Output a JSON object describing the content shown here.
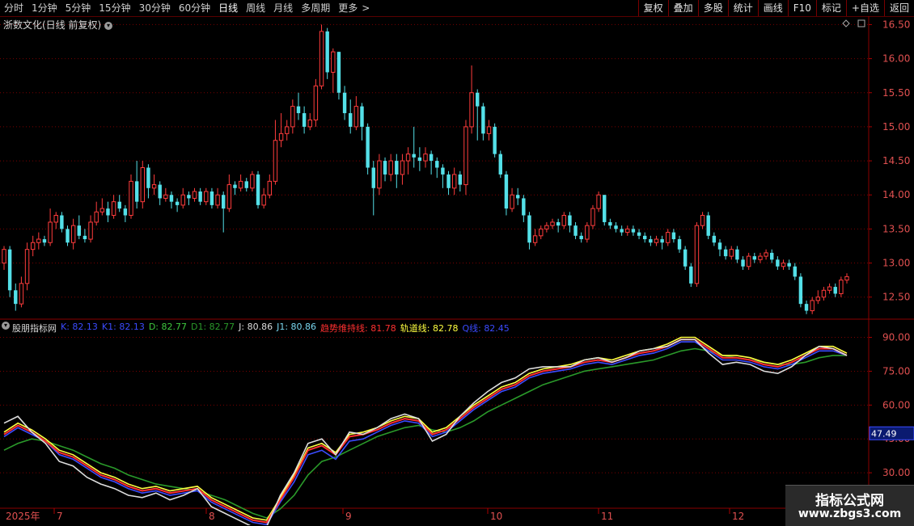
{
  "toolbar": {
    "tabs": [
      "分时",
      "1分钟",
      "5分钟",
      "15分钟",
      "30分钟",
      "60分钟",
      "日线",
      "周线",
      "月线",
      "多周期",
      "更多"
    ],
    "active_tab": "日线",
    "more_arrow": ">",
    "right_buttons": [
      "复权",
      "叠加",
      "多股",
      "统计",
      "画线",
      "F10",
      "标记",
      "+自选",
      "返回"
    ]
  },
  "main": {
    "title": "浙数文化(日线 前复权)",
    "price_axis": [
      "16.50",
      "16.00",
      "15.50",
      "15.00",
      "14.50",
      "14.00",
      "13.50",
      "13.00",
      "12.50"
    ]
  },
  "indicator": {
    "name": "股朋指标网",
    "legend": [
      {
        "label": "K: 82.13",
        "color": "#3b4bff"
      },
      {
        "label": "K1: 82.13",
        "color": "#3b4bff"
      },
      {
        "label": "D: 82.77",
        "color": "#3ec83e"
      },
      {
        "label": "D1: 82.77",
        "color": "#2a9a2a"
      },
      {
        "label": "J: 80.86",
        "color": "#dddddd"
      },
      {
        "label": "J1: 80.86",
        "color": "#7ad7f0"
      },
      {
        "label": "趋势维持线: 81.78",
        "color": "#ff3030"
      },
      {
        "label": "轨道线: 82.78",
        "color": "#ffff40"
      },
      {
        "label": "Q线: 82.45",
        "color": "#3b4bff"
      }
    ],
    "axis": [
      "90.00",
      "75.00",
      "60.00",
      "45.00",
      "30.00"
    ],
    "current_value": "47.49"
  },
  "time_axis": [
    "2025年",
    "7",
    "8",
    "9",
    "10",
    "11",
    "12"
  ],
  "watermark": {
    "title": "指标公式网",
    "url": "www.zbgs3.com"
  },
  "chart_data": {
    "type": "candlestick",
    "price_ylim": [
      12.2,
      16.6
    ],
    "candles": [
      [
        13.0,
        13.2,
        13.25,
        12.9
      ],
      [
        13.2,
        12.6,
        13.25,
        12.5
      ],
      [
        12.6,
        12.4,
        12.7,
        12.3
      ],
      [
        12.4,
        12.7,
        12.8,
        12.35
      ],
      [
        12.7,
        13.2,
        13.3,
        12.6
      ],
      [
        13.2,
        13.3,
        13.4,
        13.1
      ],
      [
        13.3,
        13.35,
        13.45,
        13.2
      ],
      [
        13.35,
        13.3,
        13.4,
        13.25
      ],
      [
        13.3,
        13.6,
        13.8,
        13.25
      ],
      [
        13.6,
        13.7,
        13.75,
        13.5
      ],
      [
        13.7,
        13.5,
        13.75,
        13.45
      ],
      [
        13.5,
        13.3,
        13.55,
        13.25
      ],
      [
        13.3,
        13.55,
        13.65,
        13.2
      ],
      [
        13.55,
        13.4,
        13.7,
        13.35
      ],
      [
        13.4,
        13.35,
        13.5,
        13.3
      ],
      [
        13.35,
        13.6,
        13.7,
        13.3
      ],
      [
        13.6,
        13.75,
        13.9,
        13.55
      ],
      [
        13.75,
        13.8,
        13.95,
        13.7
      ],
      [
        13.8,
        13.7,
        13.9,
        13.6
      ],
      [
        13.7,
        13.9,
        14.0,
        13.65
      ],
      [
        13.9,
        13.8,
        14.0,
        13.75
      ],
      [
        13.8,
        13.7,
        13.85,
        13.6
      ],
      [
        13.7,
        14.2,
        14.3,
        13.65
      ],
      [
        14.2,
        13.9,
        14.5,
        13.8
      ],
      [
        13.9,
        14.4,
        14.5,
        13.8
      ],
      [
        14.4,
        14.1,
        14.45,
        13.95
      ],
      [
        14.1,
        14.15,
        14.3,
        14.0
      ],
      [
        14.15,
        13.95,
        14.2,
        13.85
      ],
      [
        13.95,
        14.0,
        14.1,
        13.9
      ],
      [
        14.0,
        13.9,
        14.05,
        13.8
      ],
      [
        13.9,
        13.85,
        13.95,
        13.75
      ],
      [
        13.85,
        14.0,
        14.1,
        13.8
      ],
      [
        14.0,
        13.95,
        14.05,
        13.85
      ],
      [
        13.95,
        14.05,
        14.1,
        13.9
      ],
      [
        14.05,
        13.9,
        14.1,
        13.85
      ],
      [
        13.9,
        14.05,
        14.1,
        13.85
      ],
      [
        14.05,
        13.85,
        14.1,
        13.8
      ],
      [
        13.85,
        14.0,
        14.1,
        13.8
      ],
      [
        14.0,
        13.8,
        14.05,
        13.45
      ],
      [
        13.8,
        14.15,
        14.3,
        13.75
      ],
      [
        14.15,
        14.1,
        14.2,
        14.0
      ],
      [
        14.1,
        14.2,
        14.3,
        14.05
      ],
      [
        14.2,
        14.1,
        14.25,
        14.05
      ],
      [
        14.1,
        14.3,
        14.35,
        14.05
      ],
      [
        14.3,
        13.85,
        14.35,
        13.8
      ],
      [
        13.85,
        14.0,
        14.1,
        13.8
      ],
      [
        14.0,
        14.2,
        14.3,
        13.95
      ],
      [
        14.2,
        14.8,
        15.1,
        14.15
      ],
      [
        14.8,
        14.9,
        15.2,
        14.7
      ],
      [
        14.9,
        15.0,
        15.1,
        14.8
      ],
      [
        15.0,
        15.3,
        15.4,
        14.9
      ],
      [
        15.3,
        15.2,
        15.5,
        15.1
      ],
      [
        15.2,
        15.0,
        15.3,
        14.9
      ],
      [
        15.0,
        15.1,
        15.2,
        14.95
      ],
      [
        15.1,
        15.6,
        15.7,
        15.0
      ],
      [
        15.6,
        16.4,
        16.5,
        15.55
      ],
      [
        16.4,
        15.8,
        16.45,
        15.7
      ],
      [
        15.8,
        16.1,
        16.15,
        15.5
      ],
      [
        16.1,
        15.5,
        16.1,
        15.4
      ],
      [
        15.5,
        15.2,
        15.6,
        15.1
      ],
      [
        15.2,
        15.0,
        15.4,
        14.9
      ],
      [
        15.0,
        15.3,
        15.45,
        14.95
      ],
      [
        15.3,
        15.0,
        15.35,
        14.8
      ],
      [
        15.0,
        14.4,
        15.05,
        14.3
      ],
      [
        14.4,
        14.1,
        14.5,
        13.7
      ],
      [
        14.1,
        14.5,
        14.6,
        14.0
      ],
      [
        14.5,
        14.3,
        14.55,
        14.2
      ],
      [
        14.3,
        14.5,
        14.6,
        14.2
      ],
      [
        14.5,
        14.3,
        14.6,
        14.1
      ],
      [
        14.3,
        14.5,
        14.6,
        14.15
      ],
      [
        14.5,
        14.6,
        14.7,
        14.3
      ],
      [
        14.6,
        14.55,
        15.0,
        14.4
      ],
      [
        14.55,
        14.5,
        14.7,
        14.35
      ],
      [
        14.5,
        14.6,
        14.7,
        14.4
      ],
      [
        14.6,
        14.5,
        14.65,
        14.3
      ],
      [
        14.5,
        14.4,
        14.55,
        14.25
      ],
      [
        14.4,
        14.3,
        14.45,
        14.1
      ],
      [
        14.3,
        14.1,
        14.35,
        14.0
      ],
      [
        14.1,
        14.3,
        14.4,
        14.0
      ],
      [
        14.3,
        14.15,
        14.35,
        14.05
      ],
      [
        14.15,
        15.0,
        15.1,
        14.0
      ],
      [
        15.0,
        15.5,
        15.9,
        14.9
      ],
      [
        15.5,
        15.3,
        15.55,
        14.8
      ],
      [
        15.3,
        14.9,
        15.35,
        14.8
      ],
      [
        14.9,
        15.0,
        15.1,
        14.8
      ],
      [
        15.0,
        14.6,
        15.05,
        14.55
      ],
      [
        14.6,
        14.3,
        14.65,
        14.25
      ],
      [
        14.3,
        13.8,
        14.35,
        13.7
      ],
      [
        13.8,
        14.0,
        14.1,
        13.75
      ],
      [
        14.0,
        13.95,
        14.1,
        13.85
      ],
      [
        13.95,
        13.7,
        14.0,
        13.6
      ],
      [
        13.7,
        13.3,
        13.75,
        13.2
      ],
      [
        13.3,
        13.4,
        13.5,
        13.25
      ],
      [
        13.4,
        13.5,
        13.55,
        13.35
      ],
      [
        13.5,
        13.55,
        13.6,
        13.45
      ],
      [
        13.55,
        13.6,
        13.65,
        13.5
      ],
      [
        13.6,
        13.55,
        13.65,
        13.45
      ],
      [
        13.55,
        13.7,
        13.75,
        13.5
      ],
      [
        13.7,
        13.55,
        13.75,
        13.45
      ],
      [
        13.55,
        13.4,
        13.6,
        13.35
      ],
      [
        13.4,
        13.35,
        13.45,
        13.3
      ],
      [
        13.35,
        13.55,
        13.6,
        13.3
      ],
      [
        13.55,
        13.8,
        13.85,
        13.5
      ],
      [
        13.8,
        14.0,
        14.05,
        13.75
      ],
      [
        14.0,
        13.6,
        14.0,
        13.55
      ],
      [
        13.6,
        13.55,
        13.65,
        13.5
      ],
      [
        13.55,
        13.5,
        13.6,
        13.45
      ],
      [
        13.5,
        13.45,
        13.55,
        13.4
      ],
      [
        13.45,
        13.5,
        13.55,
        13.4
      ],
      [
        13.5,
        13.45,
        13.55,
        13.4
      ],
      [
        13.45,
        13.4,
        13.5,
        13.35
      ],
      [
        13.4,
        13.35,
        13.45,
        13.3
      ],
      [
        13.35,
        13.3,
        13.4,
        13.25
      ],
      [
        13.3,
        13.35,
        13.4,
        13.25
      ],
      [
        13.35,
        13.3,
        13.4,
        13.2
      ],
      [
        13.3,
        13.45,
        13.5,
        13.25
      ],
      [
        13.45,
        13.35,
        13.5,
        13.3
      ],
      [
        13.35,
        13.2,
        13.4,
        13.15
      ],
      [
        13.2,
        12.95,
        13.25,
        12.9
      ],
      [
        12.95,
        12.7,
        13.0,
        12.65
      ],
      [
        12.7,
        13.55,
        13.6,
        12.65
      ],
      [
        13.55,
        13.7,
        13.75,
        13.5
      ],
      [
        13.7,
        13.4,
        13.75,
        13.35
      ],
      [
        13.4,
        13.3,
        13.45,
        13.25
      ],
      [
        13.3,
        13.2,
        13.35,
        13.1
      ],
      [
        13.2,
        13.1,
        13.25,
        13.05
      ],
      [
        13.1,
        13.2,
        13.25,
        13.05
      ],
      [
        13.2,
        13.05,
        13.25,
        13.0
      ],
      [
        13.05,
        12.95,
        13.1,
        12.9
      ],
      [
        12.95,
        13.1,
        13.15,
        12.9
      ],
      [
        13.1,
        13.05,
        13.15,
        13.0
      ],
      [
        13.05,
        13.1,
        13.15,
        13.0
      ],
      [
        13.1,
        13.15,
        13.2,
        13.05
      ],
      [
        13.15,
        13.05,
        13.2,
        13.0
      ],
      [
        13.05,
        12.95,
        13.1,
        12.9
      ],
      [
        12.95,
        13.0,
        13.05,
        12.9
      ],
      [
        13.0,
        12.95,
        13.05,
        12.9
      ],
      [
        12.95,
        12.8,
        13.0,
        12.75
      ],
      [
        12.8,
        12.4,
        12.85,
        12.35
      ],
      [
        12.4,
        12.3,
        12.45,
        12.25
      ],
      [
        12.3,
        12.45,
        12.5,
        12.25
      ],
      [
        12.45,
        12.5,
        12.6,
        12.4
      ],
      [
        12.5,
        12.6,
        12.65,
        12.45
      ],
      [
        12.6,
        12.65,
        12.7,
        12.55
      ],
      [
        12.65,
        12.55,
        12.7,
        12.5
      ],
      [
        12.55,
        12.75,
        12.8,
        12.5
      ],
      [
        12.75,
        12.8,
        12.85,
        12.7
      ]
    ],
    "indicator_ylim": [
      15,
      97
    ],
    "indicator_series": [
      {
        "name": "K",
        "color": "#3b4bff",
        "values": [
          46,
          50,
          47,
          44,
          38,
          36,
          32,
          28,
          26,
          23,
          21,
          22,
          20,
          21,
          22,
          17,
          14,
          11,
          8,
          7,
          17,
          26,
          38,
          40,
          36,
          44,
          45,
          48,
          51,
          53,
          52,
          46,
          48,
          53,
          58,
          62,
          66,
          68,
          72,
          74,
          75,
          76,
          78,
          79,
          78,
          80,
          82,
          83,
          85,
          88,
          88,
          84,
          80,
          80,
          79,
          77,
          76,
          78,
          81,
          84,
          84,
          82
        ]
      },
      {
        "name": "D",
        "color": "#2a9a2a",
        "values": [
          40,
          43,
          45,
          44,
          42,
          40,
          37,
          34,
          32,
          29,
          27,
          25,
          24,
          23,
          22,
          20,
          18,
          15,
          12,
          10,
          14,
          20,
          29,
          35,
          37,
          40,
          43,
          46,
          48,
          50,
          51,
          49,
          48,
          50,
          53,
          57,
          60,
          63,
          66,
          69,
          71,
          73,
          75,
          76,
          77,
          78,
          79,
          80,
          82,
          84,
          85,
          84,
          82,
          81,
          80,
          79,
          78,
          78,
          79,
          81,
          82,
          82
        ]
      },
      {
        "name": "J",
        "color": "#dddddd",
        "values": [
          52,
          55,
          48,
          43,
          35,
          33,
          28,
          25,
          23,
          20,
          19,
          21,
          18,
          20,
          23,
          15,
          12,
          9,
          6,
          6,
          20,
          30,
          43,
          45,
          38,
          48,
          47,
          50,
          54,
          56,
          54,
          44,
          47,
          55,
          61,
          66,
          70,
          72,
          76,
          77,
          77,
          77,
          80,
          81,
          79,
          81,
          84,
          85,
          86,
          89,
          89,
          83,
          78,
          79,
          78,
          75,
          74,
          77,
          82,
          86,
          85,
          82
        ]
      },
      {
        "name": "趋势维持线",
        "color": "#ff3030",
        "values": [
          47,
          51,
          48,
          44,
          39,
          37,
          33,
          29,
          27,
          24,
          22,
          23,
          21,
          22,
          23,
          18,
          15,
          12,
          9,
          8,
          18,
          28,
          40,
          42,
          38,
          46,
          47,
          49,
          52,
          54,
          53,
          47,
          49,
          54,
          59,
          63,
          67,
          69,
          73,
          75,
          76,
          77,
          79,
          80,
          79,
          81,
          83,
          84,
          86,
          89,
          89,
          85,
          81,
          81,
          80,
          78,
          77,
          79,
          82,
          85,
          85,
          82
        ]
      },
      {
        "name": "轨道线",
        "color": "#ffff40",
        "values": [
          48,
          52,
          49,
          45,
          40,
          38,
          34,
          30,
          28,
          25,
          23,
          24,
          22,
          23,
          24,
          19,
          16,
          13,
          10,
          9,
          19,
          29,
          41,
          43,
          39,
          47,
          48,
          50,
          53,
          55,
          54,
          48,
          50,
          55,
          60,
          64,
          68,
          70,
          74,
          76,
          77,
          78,
          80,
          81,
          80,
          82,
          84,
          85,
          87,
          90,
          90,
          86,
          82,
          82,
          81,
          79,
          78,
          80,
          83,
          86,
          86,
          83
        ]
      }
    ]
  }
}
